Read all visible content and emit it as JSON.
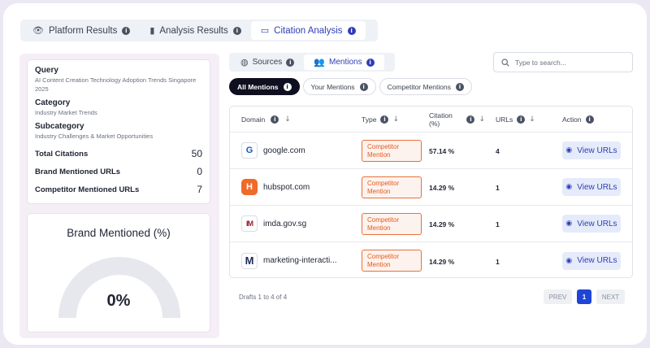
{
  "top_tabs": [
    {
      "label": "Platform Results",
      "icon": "eye-icon"
    },
    {
      "label": "Analysis Results",
      "icon": "bar-chart-icon"
    },
    {
      "label": "Citation Analysis",
      "icon": "message-icon",
      "active": true
    }
  ],
  "query_card": {
    "query_label": "Query",
    "query_value": "AI Content Creation Technology Adoption Trends Singapore 2025",
    "category_label": "Category",
    "category_value": "Industry Market Trends",
    "subcategory_label": "Subcategory",
    "subcategory_value": "Industry Challenges & Market Opportunities",
    "stats": [
      {
        "label": "Total Citations",
        "value": "50"
      },
      {
        "label": "Brand Mentioned URLs",
        "value": "0"
      },
      {
        "label": "Competitor Mentioned URLs",
        "value": "7"
      }
    ]
  },
  "brand_card": {
    "title": "Brand Mentioned (%)",
    "value": "0%",
    "fraction": 0,
    "track_color": "#e6e8ee"
  },
  "sub_tabs": [
    {
      "label": "Sources",
      "icon": "globe-icon"
    },
    {
      "label": "Mentions",
      "icon": "users-icon",
      "active": true
    }
  ],
  "search": {
    "placeholder": "Type to search..."
  },
  "filters": [
    {
      "label": "All Mentions",
      "active": true
    },
    {
      "label": "Your Mentions"
    },
    {
      "label": "Competitor Mentions"
    }
  ],
  "table": {
    "headers": {
      "domain": "Domain",
      "type": "Type",
      "citation": "Citation (%)",
      "urls": "URLs",
      "action": "Action"
    },
    "rows": [
      {
        "domain": "google.com",
        "logo": "G",
        "logo_color": "#1a56c4",
        "type": "Competitor Mention",
        "citation": "57.14 %",
        "urls": "4",
        "action": "View URLs"
      },
      {
        "domain": "hubspot.com",
        "logo": "H",
        "logo_color": "#f06a2a",
        "type": "Competitor Mention",
        "citation": "14.29 %",
        "urls": "1",
        "action": "View URLs"
      },
      {
        "domain": "imda.gov.sg",
        "logo": "IM",
        "logo_color": "#9b1b2e",
        "type": "Competitor Mention",
        "citation": "14.29 %",
        "urls": "1",
        "action": "View URLs"
      },
      {
        "domain": "marketing-interacti...",
        "logo": "M",
        "logo_color": "#1c2a5e",
        "type": "Competitor Mention",
        "citation": "14.29 %",
        "urls": "1",
        "action": "View URLs"
      }
    ]
  },
  "footer": {
    "summary": "Drafts 1 to 4 of 4",
    "prev": "PREV",
    "page": "1",
    "next": "NEXT"
  }
}
